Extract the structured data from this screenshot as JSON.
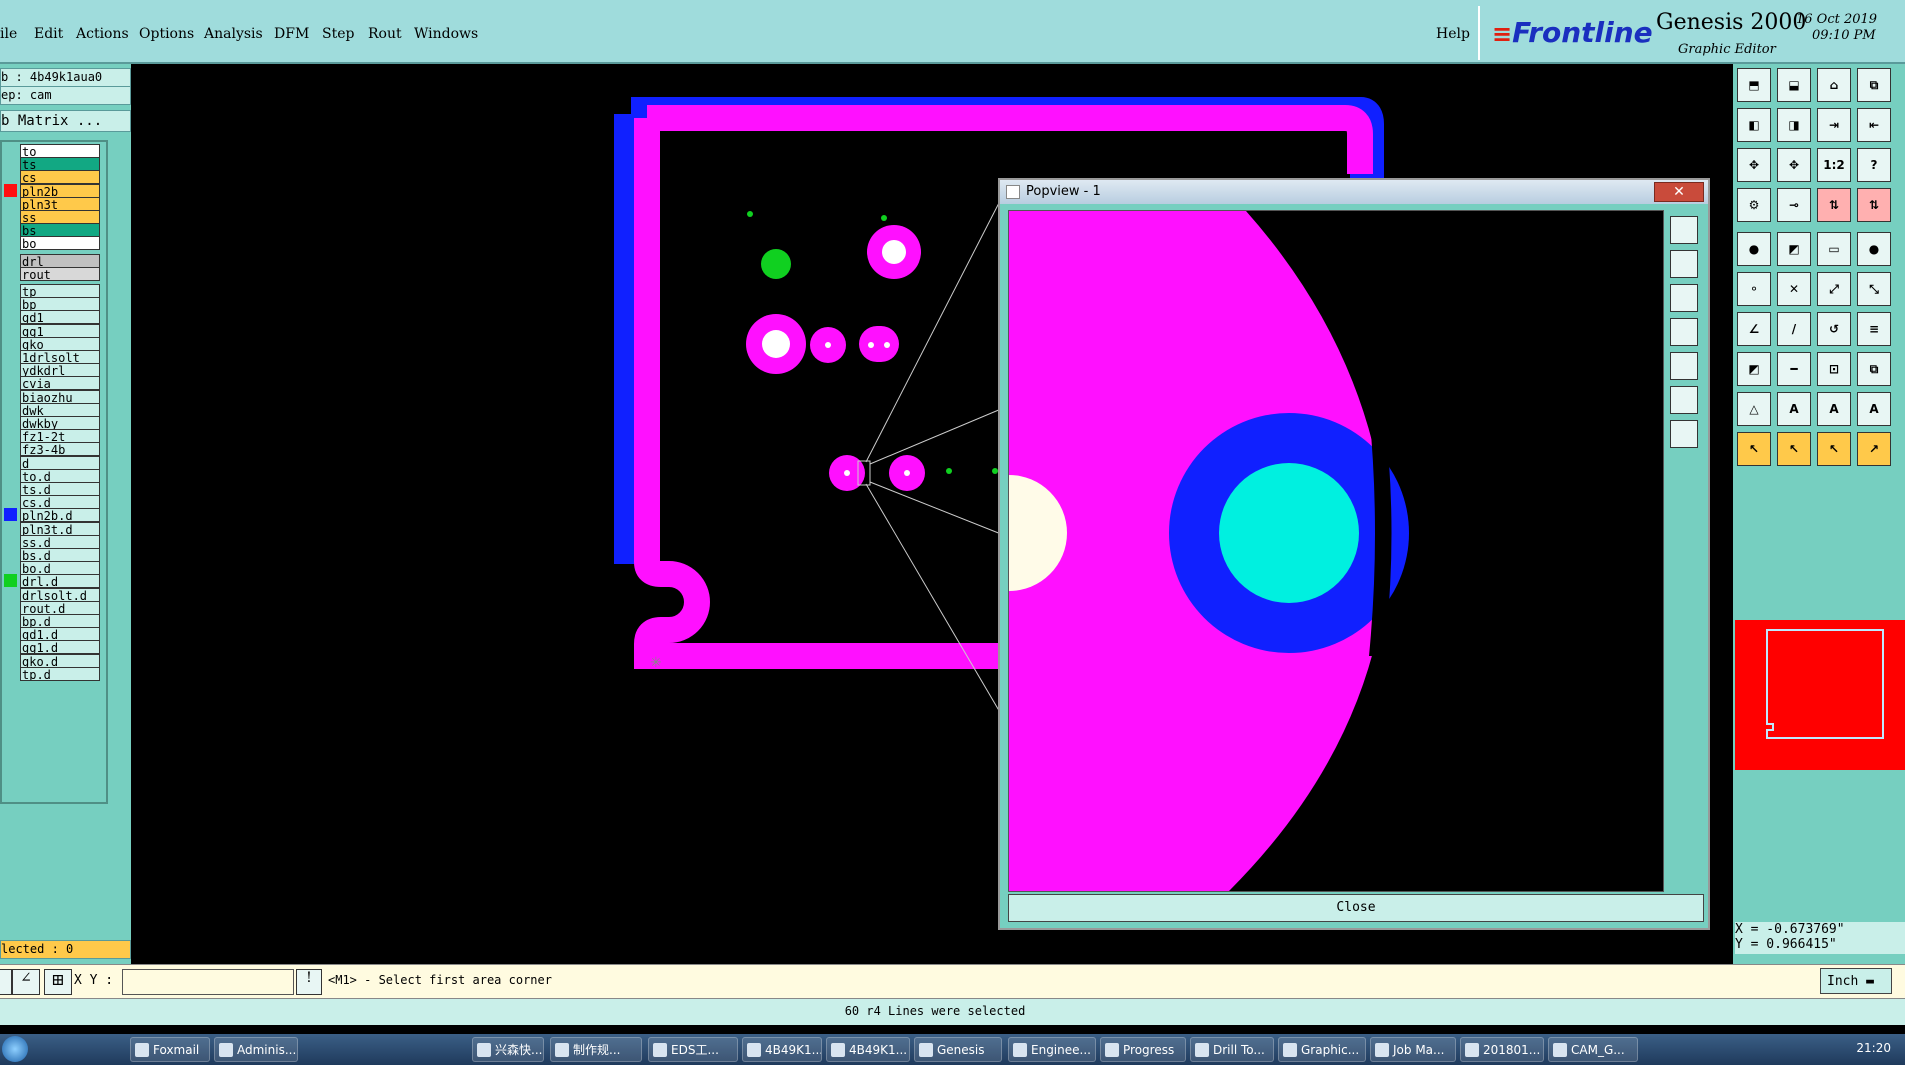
{
  "menu": {
    "items": [
      "ile",
      "Edit",
      "Actions",
      "Options",
      "Analysis",
      "DFM",
      "Step",
      "Rout",
      "Windows"
    ],
    "help": "Help"
  },
  "brand": {
    "logo": "Frontline",
    "product": "Genesis 2000",
    "subtitle": "Graphic Editor",
    "date": "16 Oct 2019",
    "time": "09:10 PM"
  },
  "left": {
    "job": "b : 4b49k1aua0",
    "step": "ep: cam",
    "matrix_button": "b Matrix ...",
    "selected": "lected : 0",
    "layers": [
      {
        "name": "to",
        "bg": "#ffffff",
        "swatch": ""
      },
      {
        "name": "ts",
        "bg": "#12a883",
        "swatch": ""
      },
      {
        "name": "cs",
        "bg": "#ffc94a",
        "swatch": ""
      },
      {
        "name": "pln2b",
        "bg": "#ffc94a",
        "swatch": "#ff1010"
      },
      {
        "name": "pln3t",
        "bg": "#ffc94a",
        "swatch": ""
      },
      {
        "name": "ss",
        "bg": "#ffc94a",
        "swatch": ""
      },
      {
        "name": "bs",
        "bg": "#12a883",
        "swatch": ""
      },
      {
        "name": "bo",
        "bg": "#ffffff",
        "swatch": ""
      },
      {
        "name": "drl",
        "bg": "#c0c0c0",
        "swatch": ""
      },
      {
        "name": "rout",
        "bg": "#d8d8d8",
        "swatch": ""
      },
      {
        "name": "tp",
        "bg": "#c9efe9",
        "swatch": ""
      },
      {
        "name": "bp",
        "bg": "#c9efe9",
        "swatch": ""
      },
      {
        "name": "gd1",
        "bg": "#c9efe9",
        "swatch": ""
      },
      {
        "name": "gg1",
        "bg": "#c9efe9",
        "swatch": ""
      },
      {
        "name": "gko",
        "bg": "#c9efe9",
        "swatch": ""
      },
      {
        "name": "1drlsolt",
        "bg": "#c9efe9",
        "swatch": ""
      },
      {
        "name": "ydkdrl",
        "bg": "#c9efe9",
        "swatch": ""
      },
      {
        "name": "cvia",
        "bg": "#c9efe9",
        "swatch": ""
      },
      {
        "name": "biaozhu",
        "bg": "#c9efe9",
        "swatch": ""
      },
      {
        "name": "dwk",
        "bg": "#c9efe9",
        "swatch": ""
      },
      {
        "name": "dwkby",
        "bg": "#c9efe9",
        "swatch": ""
      },
      {
        "name": "fz1-2t",
        "bg": "#c9efe9",
        "swatch": ""
      },
      {
        "name": "fz3-4b",
        "bg": "#c9efe9",
        "swatch": ""
      },
      {
        "name": "d",
        "bg": "#c9efe9",
        "swatch": ""
      },
      {
        "name": "to.d",
        "bg": "#c9efe9",
        "swatch": ""
      },
      {
        "name": "ts.d",
        "bg": "#c9efe9",
        "swatch": ""
      },
      {
        "name": "cs.d",
        "bg": "#c9efe9",
        "swatch": ""
      },
      {
        "name": "pln2b.d",
        "bg": "#c9efe9",
        "swatch": "#1020ff"
      },
      {
        "name": "pln3t.d",
        "bg": "#c9efe9",
        "swatch": ""
      },
      {
        "name": "ss.d",
        "bg": "#c9efe9",
        "swatch": ""
      },
      {
        "name": "bs.d",
        "bg": "#c9efe9",
        "swatch": ""
      },
      {
        "name": "bo.d",
        "bg": "#c9efe9",
        "swatch": ""
      },
      {
        "name": "drl.d",
        "bg": "#c9efe9",
        "swatch": "#10d020"
      },
      {
        "name": "drlsolt.d",
        "bg": "#c9efe9",
        "swatch": ""
      },
      {
        "name": "rout.d",
        "bg": "#c9efe9",
        "swatch": ""
      },
      {
        "name": "bp.d",
        "bg": "#c9efe9",
        "swatch": ""
      },
      {
        "name": "gd1.d",
        "bg": "#c9efe9",
        "swatch": ""
      },
      {
        "name": "gg1.d",
        "bg": "#c9efe9",
        "swatch": ""
      },
      {
        "name": "gko.d",
        "bg": "#c9efe9",
        "swatch": ""
      },
      {
        "name": "tp.d",
        "bg": "#c9efe9",
        "swatch": ""
      }
    ]
  },
  "popview": {
    "title": "Popview - 1",
    "close_label": "Close"
  },
  "right": {
    "coord_x": "X = -0.673769\"",
    "coord_y": "Y = 0.966415\"",
    "zoom_labels": [
      "1:2"
    ],
    "unit": "Inch"
  },
  "command": {
    "xy_label": "X Y :",
    "xy_value": "",
    "prompt": "<M1> - Select first area corner"
  },
  "status": {
    "message": "60 r4 Lines were selected"
  },
  "taskbar": {
    "items": [
      "Foxmail",
      "Adminis...",
      "兴森快...",
      "制作规...",
      "EDS工...",
      "4B49K1...",
      "4B49K1...",
      "Genesis",
      "Enginee...",
      "Progress",
      "Drill To...",
      "Graphic...",
      "Job Ma...",
      "201801...",
      "CAM_G..."
    ],
    "clock": "21:20"
  },
  "colors": {
    "panel": "#76cfc0",
    "menubar": "#9fdcdc",
    "magenta": "#ff10ff",
    "blue": "#1020ff",
    "cyan": "#00f0e0",
    "green": "#10d020",
    "cream": "#fffbe8"
  }
}
